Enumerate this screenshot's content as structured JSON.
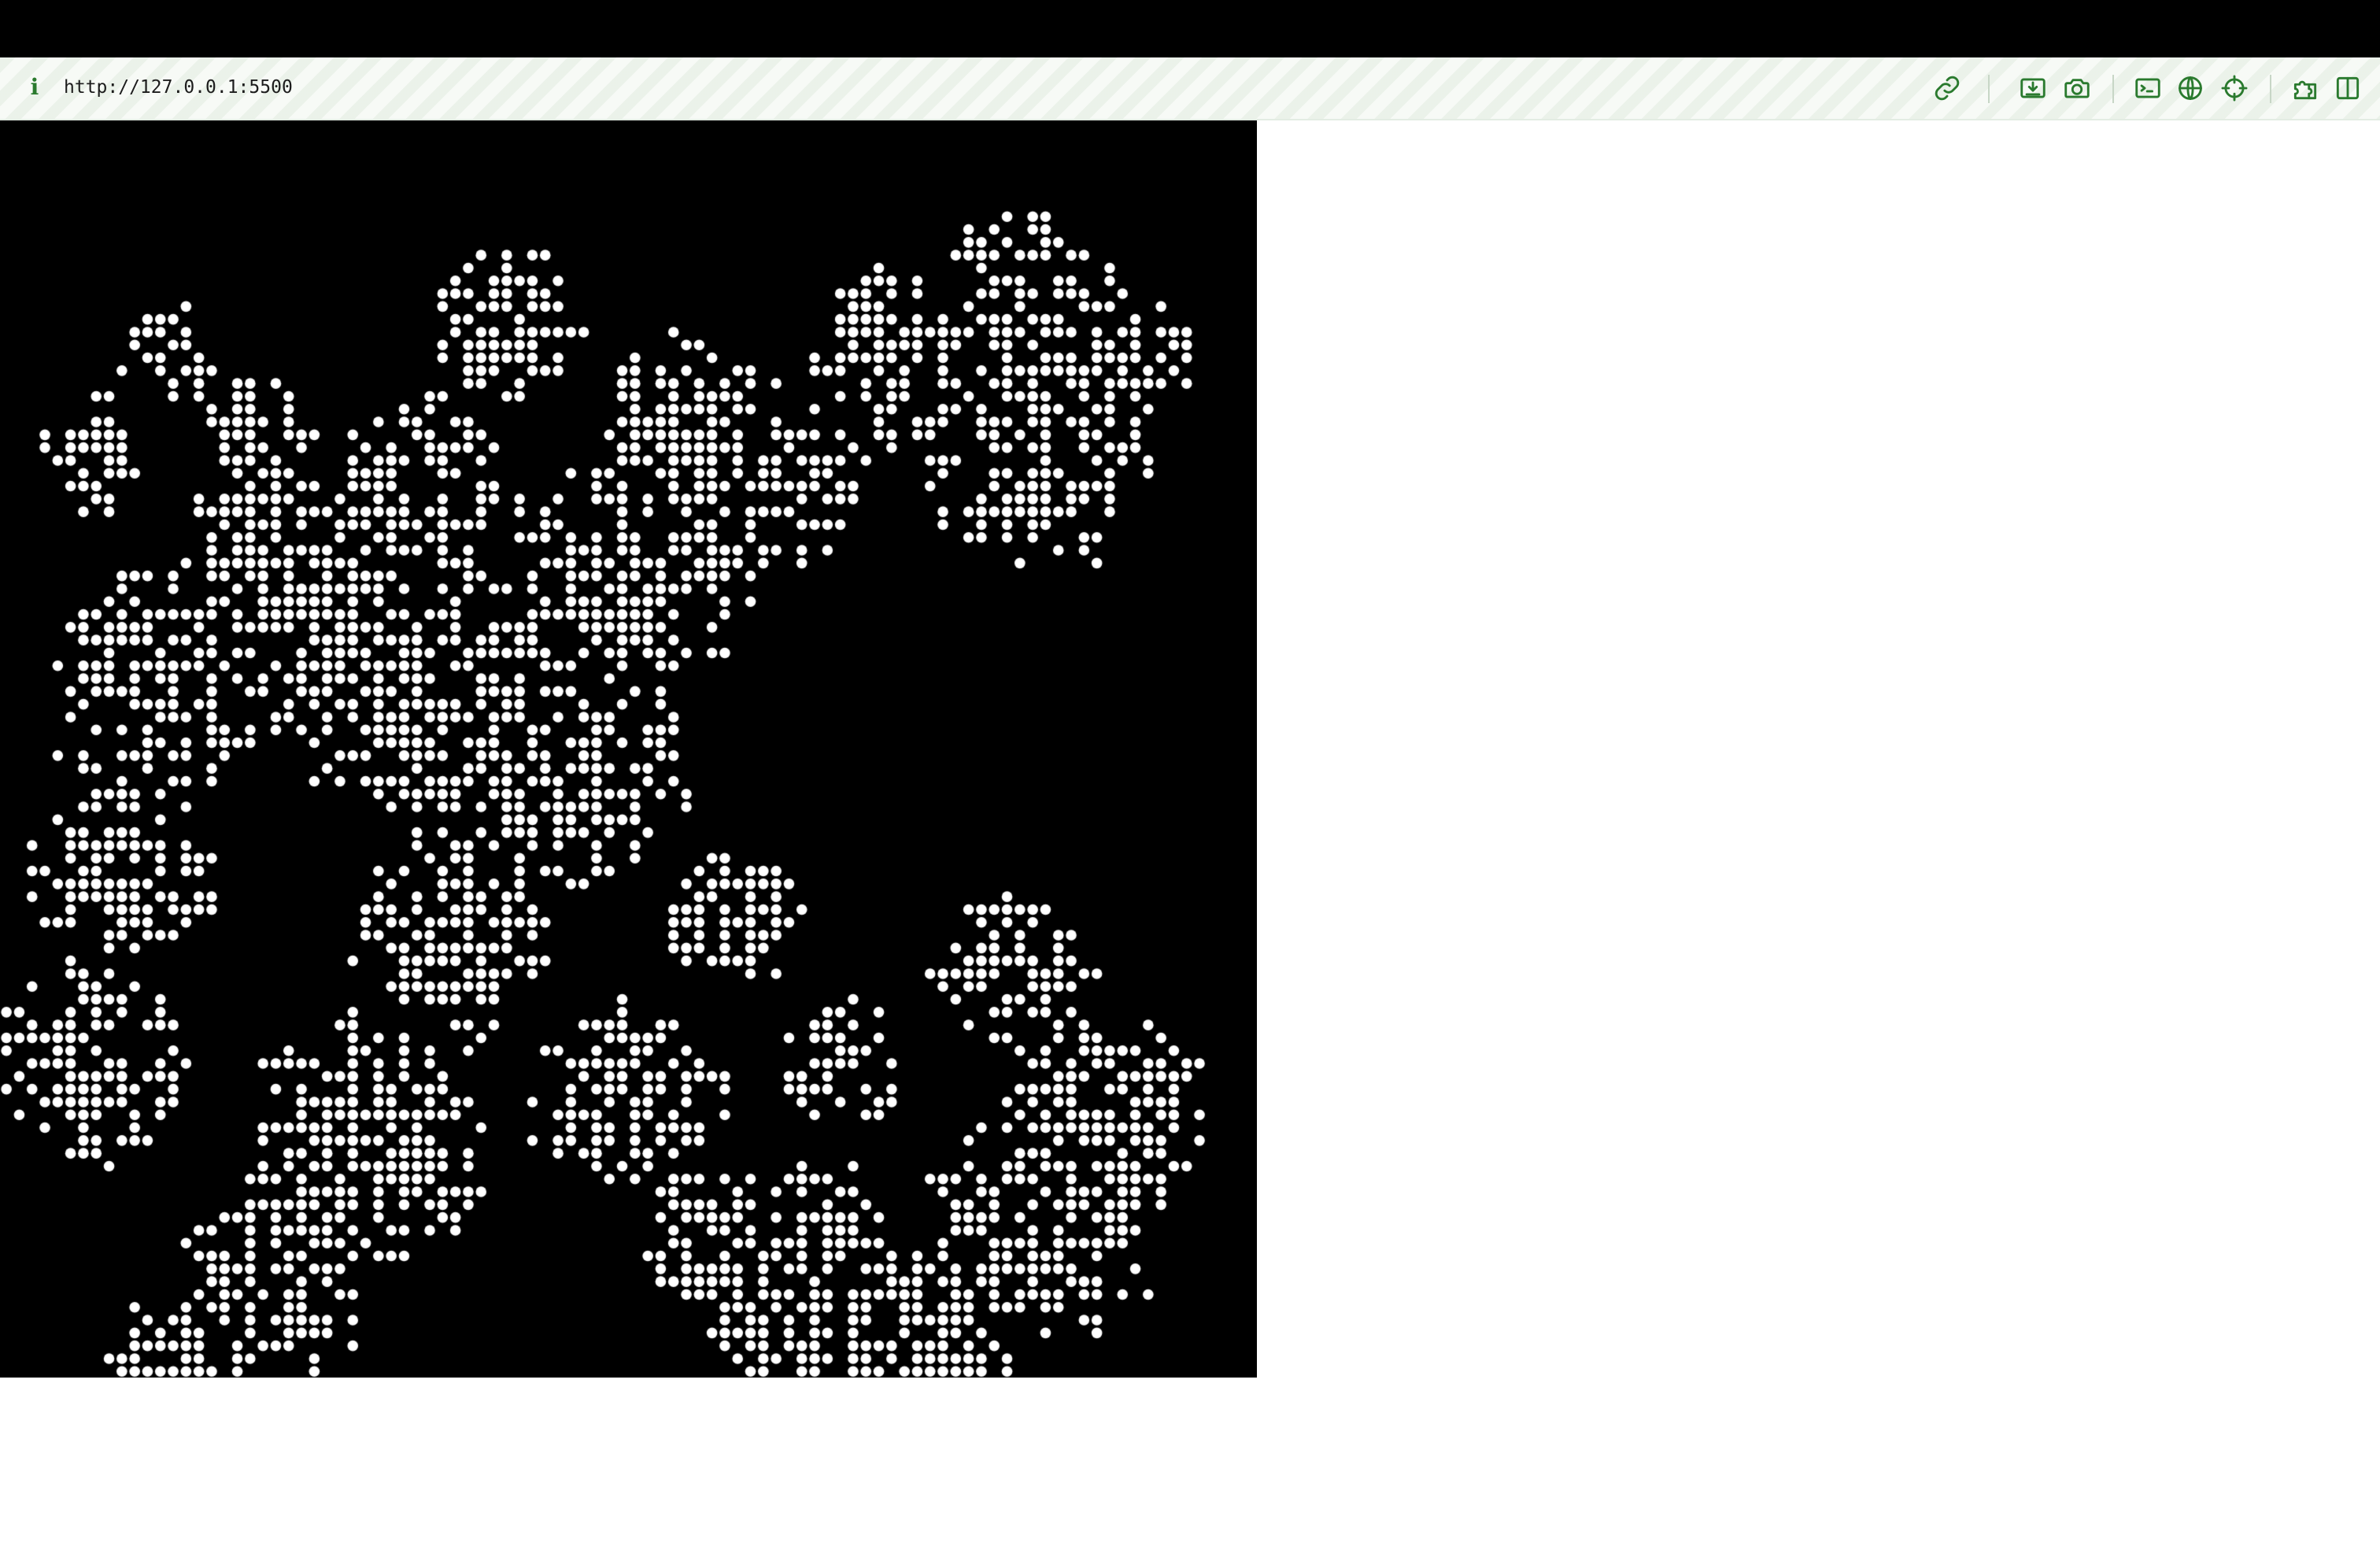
{
  "browser": {
    "url": "http://127.0.0.1:5500",
    "accent_color": "#2a7a2e",
    "toolbar_icons": [
      "link-icon",
      "save-icon",
      "camera-icon",
      "terminal-icon",
      "globe-icon",
      "crosshair-icon",
      "extensions-icon",
      "split-view-icon"
    ]
  },
  "simulation": {
    "background_color": "#000000",
    "cell_color": "#ffffff",
    "pattern": "cellular-automaton"
  }
}
